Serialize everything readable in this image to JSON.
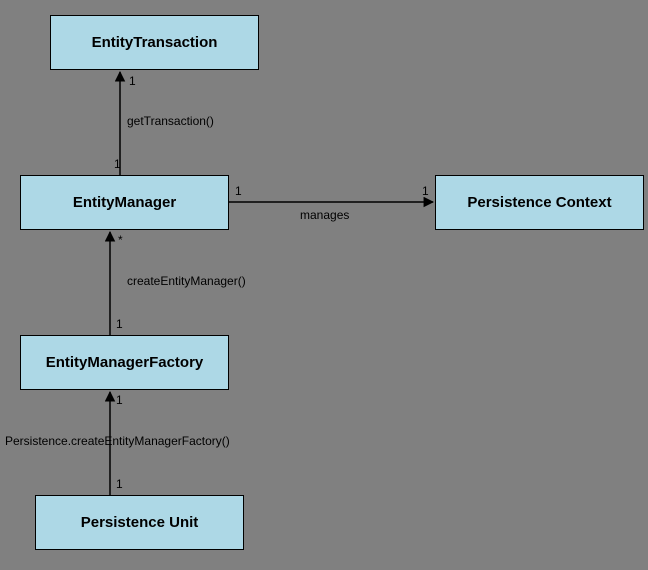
{
  "boxes": {
    "entityTransaction": "EntityTransaction",
    "entityManager": "EntityManager",
    "persistenceContext": "Persistence Context",
    "entityManagerFactory": "EntityManagerFactory",
    "persistenceUnit": "Persistence Unit"
  },
  "labels": {
    "getTransaction": "getTransaction()",
    "manages": "manages",
    "createEntityManager": "createEntityManager()",
    "createFactory": "Persistence.createEntityManagerFactory()",
    "one_a": "1",
    "one_b": "1",
    "one_c": "1",
    "one_d": "1",
    "one_e": "1",
    "one_f": "1",
    "one_g": "1",
    "star": "*"
  }
}
